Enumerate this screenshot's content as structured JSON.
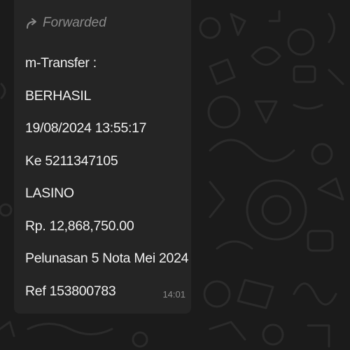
{
  "chat": {
    "background_color": "#1b1b1b",
    "bubble_color": "#252525"
  },
  "message": {
    "forwarded_label": "Forwarded",
    "forwarded_icon": "forward-arrow-icon",
    "lines": [
      "m-Transfer :",
      "BERHASIL",
      "19/08/2024 13:55:17",
      "Ke 5211347105",
      "LASINO",
      "Rp. 12,868,750.00",
      "Pelunasan 5 Nota Mei 2024",
      "Ref 153800783"
    ],
    "time": "14:01"
  }
}
